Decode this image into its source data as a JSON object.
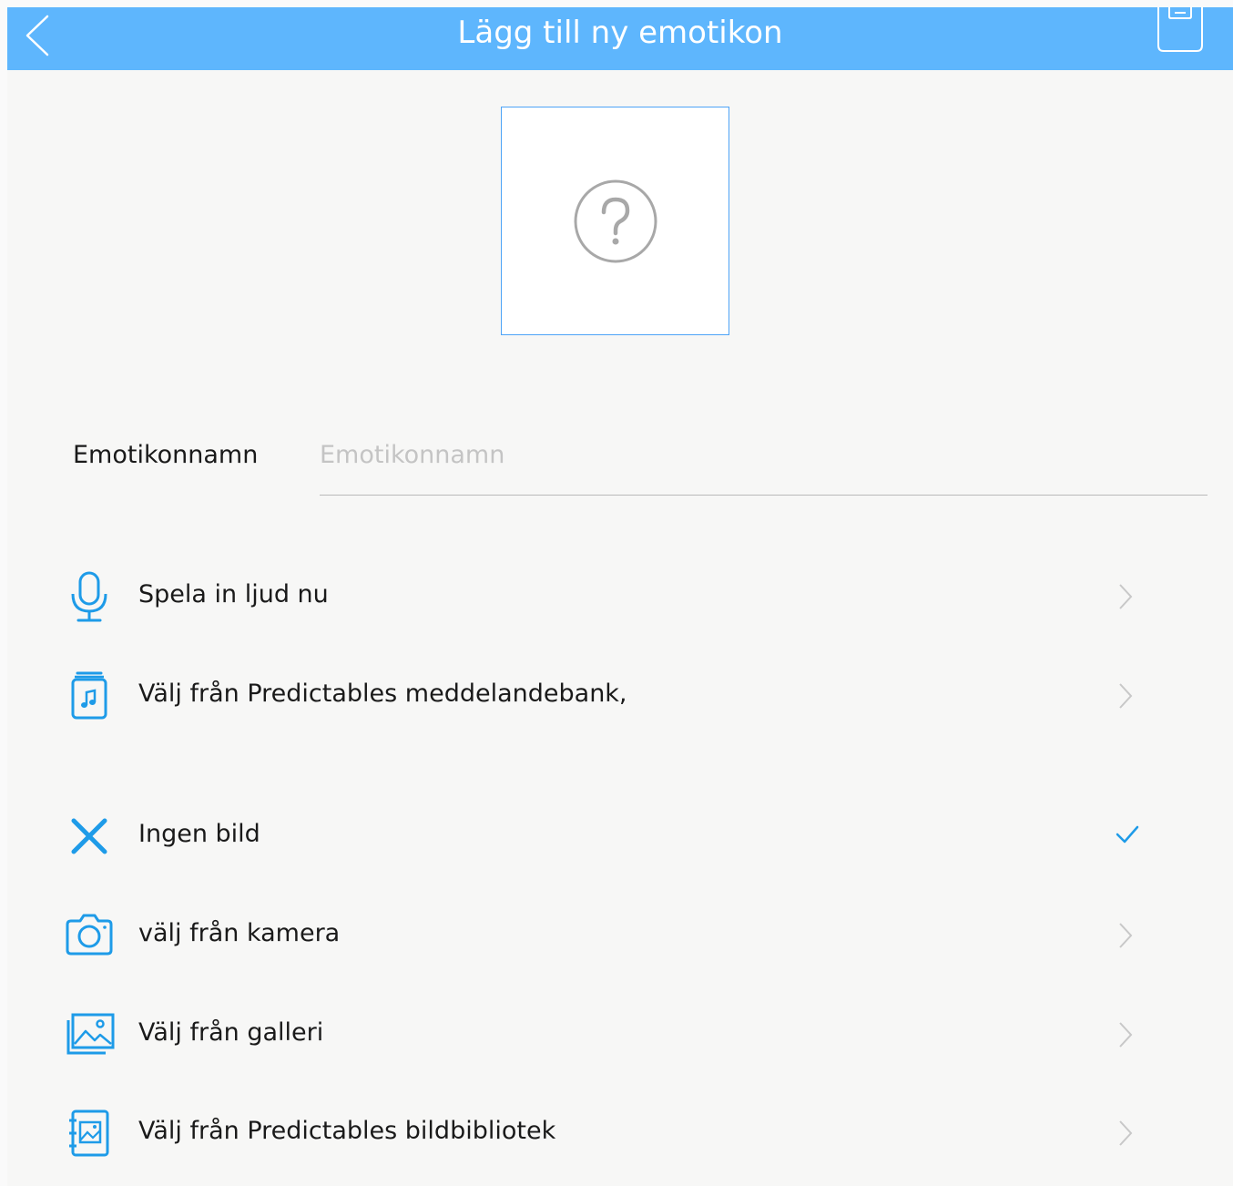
{
  "header": {
    "title": "Lägg till ny emotikon",
    "back_icon": "chevron-left-icon",
    "save_icon": "save-icon",
    "background_color": "#5eb6fd"
  },
  "image_preview": {
    "icon": "question-circle-icon",
    "border_color": "#4da3f7"
  },
  "name_field": {
    "label": "Emotikonnamn",
    "placeholder": "Emotikonnamn",
    "value": ""
  },
  "sound_options": [
    {
      "label": "Spela in ljud nu",
      "icon": "microphone-icon",
      "trailing": "chevron-right-icon"
    },
    {
      "label": "Välj från Predictables meddelandebank,",
      "icon": "music-library-icon",
      "trailing": "chevron-right-icon"
    }
  ],
  "image_options": [
    {
      "label": "Ingen bild",
      "icon": "close-icon",
      "trailing": "checkmark-icon",
      "selected": true
    },
    {
      "label": "välj från kamera",
      "icon": "camera-icon",
      "trailing": "chevron-right-icon"
    },
    {
      "label": "Välj från galleri",
      "icon": "gallery-icon",
      "trailing": "chevron-right-icon"
    },
    {
      "label": "Välj från Predictables bildbibliotek",
      "icon": "image-library-icon",
      "trailing": "chevron-right-icon"
    }
  ],
  "colors": {
    "accent": "#1e9be8",
    "chevron": "#c8c8c8"
  }
}
